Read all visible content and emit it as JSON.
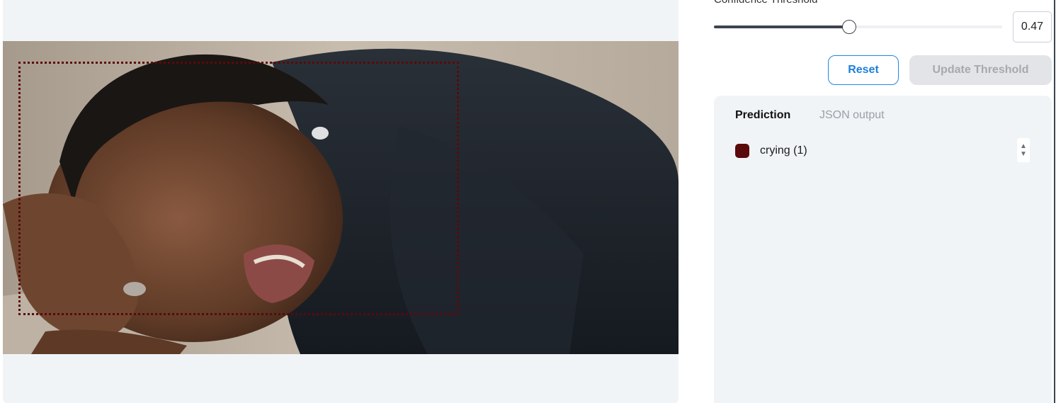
{
  "threshold": {
    "label": "Confidence Threshold",
    "value": "0.47",
    "fraction": 0.47
  },
  "buttons": {
    "reset": "Reset",
    "update": "Update Threshold"
  },
  "results": {
    "tabs": [
      "Prediction",
      "JSON output"
    ],
    "predictions": [
      {
        "label": "crying (1)",
        "color": "#5a0a0a"
      }
    ]
  },
  "colors": {
    "accent": "#1e88e5",
    "bbox": "#5a0a0a",
    "panel_bg": "#f1f4f7"
  }
}
